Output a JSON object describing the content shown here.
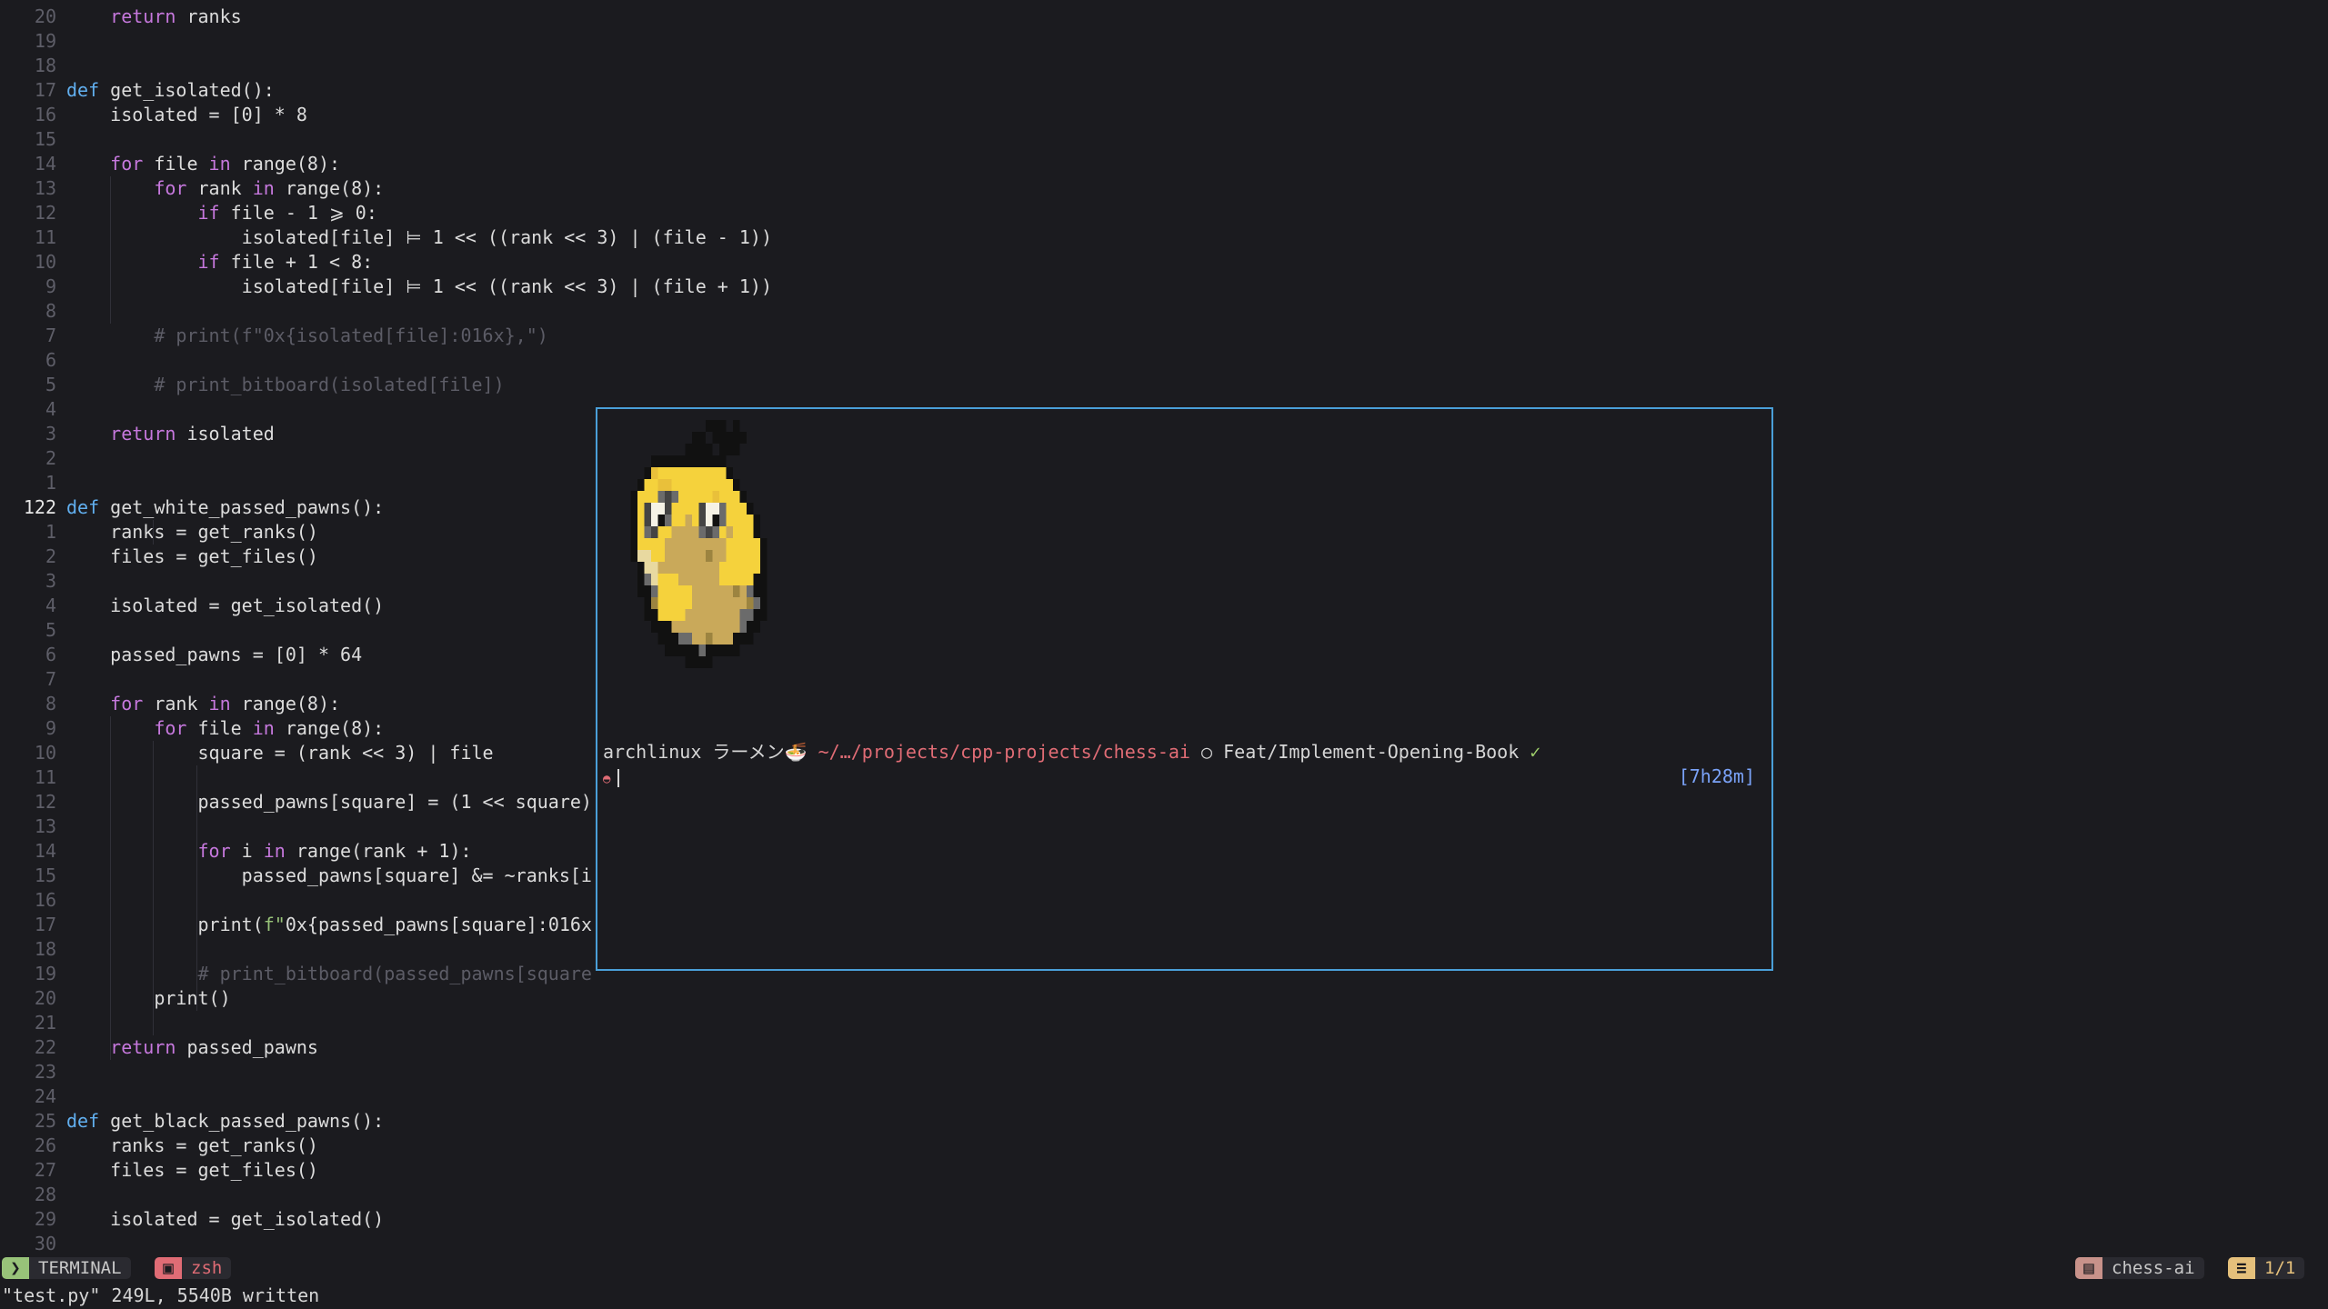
{
  "editor": {
    "lines": [
      {
        "num": "20",
        "code": "    return ranks"
      },
      {
        "num": "19",
        "code": ""
      },
      {
        "num": "18",
        "code": ""
      },
      {
        "num": "17",
        "code": "def get_isolated():"
      },
      {
        "num": "16",
        "code": "    isolated = [0] * 8"
      },
      {
        "num": "15",
        "code": ""
      },
      {
        "num": "14",
        "code": "    for file in range(8):"
      },
      {
        "num": "13",
        "code": "        for rank in range(8):"
      },
      {
        "num": "12",
        "code": "            if file - 1 ⩾ 0:"
      },
      {
        "num": "11",
        "code": "                isolated[file] ⊨ 1 << ((rank << 3) | (file - 1))"
      },
      {
        "num": "10",
        "code": "            if file + 1 < 8:"
      },
      {
        "num": "9",
        "code": "                isolated[file] ⊨ 1 << ((rank << 3) | (file + 1))"
      },
      {
        "num": "8",
        "code": ""
      },
      {
        "num": "7",
        "code": "        # print(f\"0x{isolated[file]:016x},\")"
      },
      {
        "num": "6",
        "code": ""
      },
      {
        "num": "5",
        "code": "        # print_bitboard(isolated[file])"
      },
      {
        "num": "4",
        "code": ""
      },
      {
        "num": "3",
        "code": "    return isolated"
      },
      {
        "num": "2",
        "code": ""
      },
      {
        "num": "1",
        "code": ""
      },
      {
        "num": "122",
        "code": "def get_white_passed_pawns():"
      },
      {
        "num": "1",
        "code": "    ranks = get_ranks()"
      },
      {
        "num": "2",
        "code": "    files = get_files()"
      },
      {
        "num": "3",
        "code": ""
      },
      {
        "num": "4",
        "code": "    isolated = get_isolated()"
      },
      {
        "num": "5",
        "code": ""
      },
      {
        "num": "6",
        "code": "    passed_pawns = [0] * 64"
      },
      {
        "num": "7",
        "code": ""
      },
      {
        "num": "8",
        "code": "    for rank in range(8):"
      },
      {
        "num": "9",
        "code": "        for file in range(8):"
      },
      {
        "num": "10",
        "code": "            square = (rank << 3) | file"
      },
      {
        "num": "11",
        "code": ""
      },
      {
        "num": "12",
        "code": "            passed_pawns[square] = (1 << square)"
      },
      {
        "num": "13",
        "code": ""
      },
      {
        "num": "14",
        "code": "            for i in range(rank + 1):"
      },
      {
        "num": "15",
        "code": "                passed_pawns[square] &= ~ranks[i"
      },
      {
        "num": "16",
        "code": ""
      },
      {
        "num": "17",
        "code": "            print(f\"0x{passed_pawns[square]:016x"
      },
      {
        "num": "18",
        "code": ""
      },
      {
        "num": "19",
        "code": "            # print_bitboard(passed_pawns[square"
      },
      {
        "num": "20",
        "code": "        print()"
      },
      {
        "num": "21",
        "code": ""
      },
      {
        "num": "22",
        "code": "    return passed_pawns"
      },
      {
        "num": "23",
        "code": ""
      },
      {
        "num": "24",
        "code": ""
      },
      {
        "num": "25",
        "code": "def get_black_passed_pawns():"
      },
      {
        "num": "26",
        "code": "    ranks = get_ranks()"
      },
      {
        "num": "27",
        "code": "    files = get_files()"
      },
      {
        "num": "28",
        "code": ""
      },
      {
        "num": "29",
        "code": "    isolated = get_isolated()"
      },
      {
        "num": "30",
        "code": ""
      }
    ],
    "current_line_index": 20
  },
  "terminal": {
    "prompt_host": "archlinux",
    "prompt_name": "ラーメン🍜",
    "prompt_path": "~/…/projects/cpp-projects/chess-ai",
    "branch_icon": "○",
    "branch": "Feat/Implement-Opening-Book",
    "branch_status": "✓",
    "prompt_symbol": "◓",
    "timer": "[7h28m]"
  },
  "statusline": {
    "mode": "TERMINAL",
    "mode_icon": "terminal-icon",
    "shell": "zsh",
    "shell_icon": "terminal-box-icon",
    "project": "chess-ai",
    "project_icon": "folder-icon",
    "position": "1/1",
    "position_icon": "lines-icon",
    "colors": {
      "mode_bg": "#98c379",
      "shell_bg": "#e06c75",
      "project_bg": "#c8928a",
      "position_bg": "#e5c07b"
    }
  },
  "cmdline": "\"test.py\" 249L, 5540B written"
}
